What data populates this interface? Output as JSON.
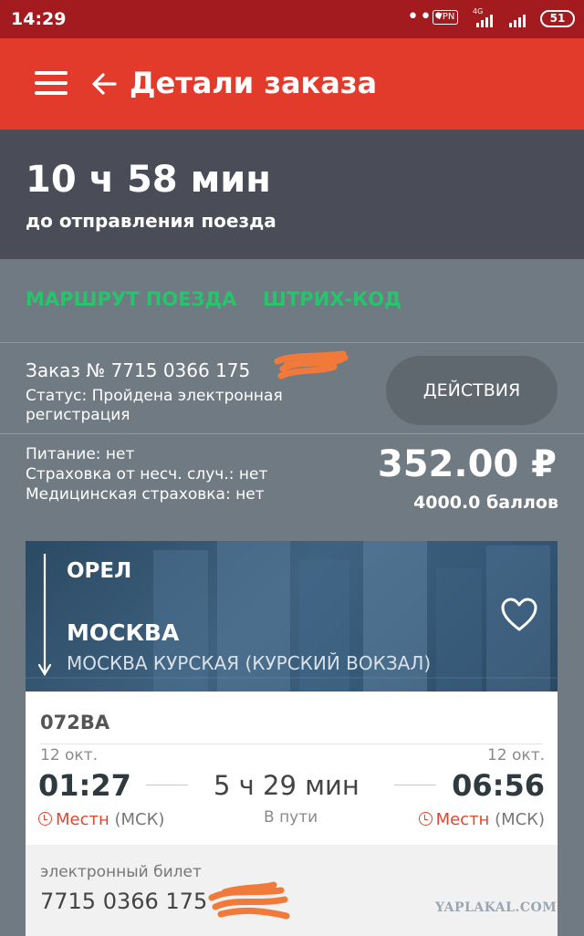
{
  "status_bar": {
    "time": "14:29",
    "dots": "•••",
    "vpn": "VPN",
    "network": "4G",
    "battery": "51"
  },
  "app_bar": {
    "title": "Детали заказа",
    "menu_icon": "hamburger-menu-icon",
    "back_icon": "arrow-left-icon"
  },
  "countdown": {
    "time": "10 ч 58 мин",
    "subtitle": "до отправления поезда"
  },
  "tabs": [
    {
      "label": "МАРШРУТ ПОЕЗДА"
    },
    {
      "label": "ШТРИХ-КОД"
    }
  ],
  "order": {
    "number": "Заказ № 7715 0366 175",
    "status": "Статус: Пройдена электронная регистрация",
    "actions_label": "ДЕЙСТВИЯ"
  },
  "services": {
    "food": "Питание: нет",
    "insurance": "Страховка от несч. случ.: нет",
    "medical": "Медицинская страховка: нет",
    "price": "352.00 ₽",
    "points": "4000.0  баллов"
  },
  "route": {
    "from": "ОРЕЛ",
    "to": "МОСКВА",
    "station": "МОСКВА КУРСКАЯ (КУРСКИЙ ВОКЗАЛ)"
  },
  "train": {
    "number": "072ВА",
    "dep_date": "12 окт.",
    "dep_time": "01:27",
    "arr_date": "12 окт.",
    "arr_time": "06:56",
    "duration": "5 ч 29 мин",
    "duration_label": "В пути",
    "tz_local": "Местн",
    "tz_msk": "(МСК)"
  },
  "eticket": {
    "label": "электронный билет",
    "number": "7715 0366 175"
  },
  "watermark": "YAPLAKAL.COM",
  "colors": {
    "status_bar": "#a31b1f",
    "app_bar": "#e23b2b",
    "countdown_bg": "#4a4d57",
    "panel_bg": "#6f7a82",
    "tab_green": "#27c46d",
    "accent_red": "#e2452f"
  }
}
